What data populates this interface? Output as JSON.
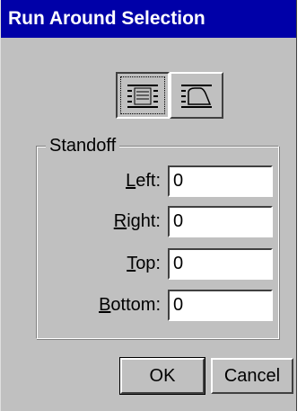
{
  "window": {
    "title": "Run Around Selection"
  },
  "modes": [
    {
      "name": "rectangular-runaround",
      "icon": "text-wrap-rectangle-icon",
      "active": true
    },
    {
      "name": "contour-runaround",
      "icon": "text-wrap-contour-icon",
      "active": false
    }
  ],
  "standoff": {
    "label": "Standoff",
    "fields": [
      {
        "key": "left",
        "mnemonic": "L",
        "rest": "eft:",
        "value": "0"
      },
      {
        "key": "right",
        "mnemonic": "R",
        "rest": "ight:",
        "value": "0"
      },
      {
        "key": "top",
        "mnemonic": "T",
        "rest": "op:",
        "value": "0"
      },
      {
        "key": "bottom",
        "mnemonic": "B",
        "rest": "ottom:",
        "value": "0"
      }
    ]
  },
  "buttons": {
    "ok": "OK",
    "cancel": "Cancel"
  }
}
